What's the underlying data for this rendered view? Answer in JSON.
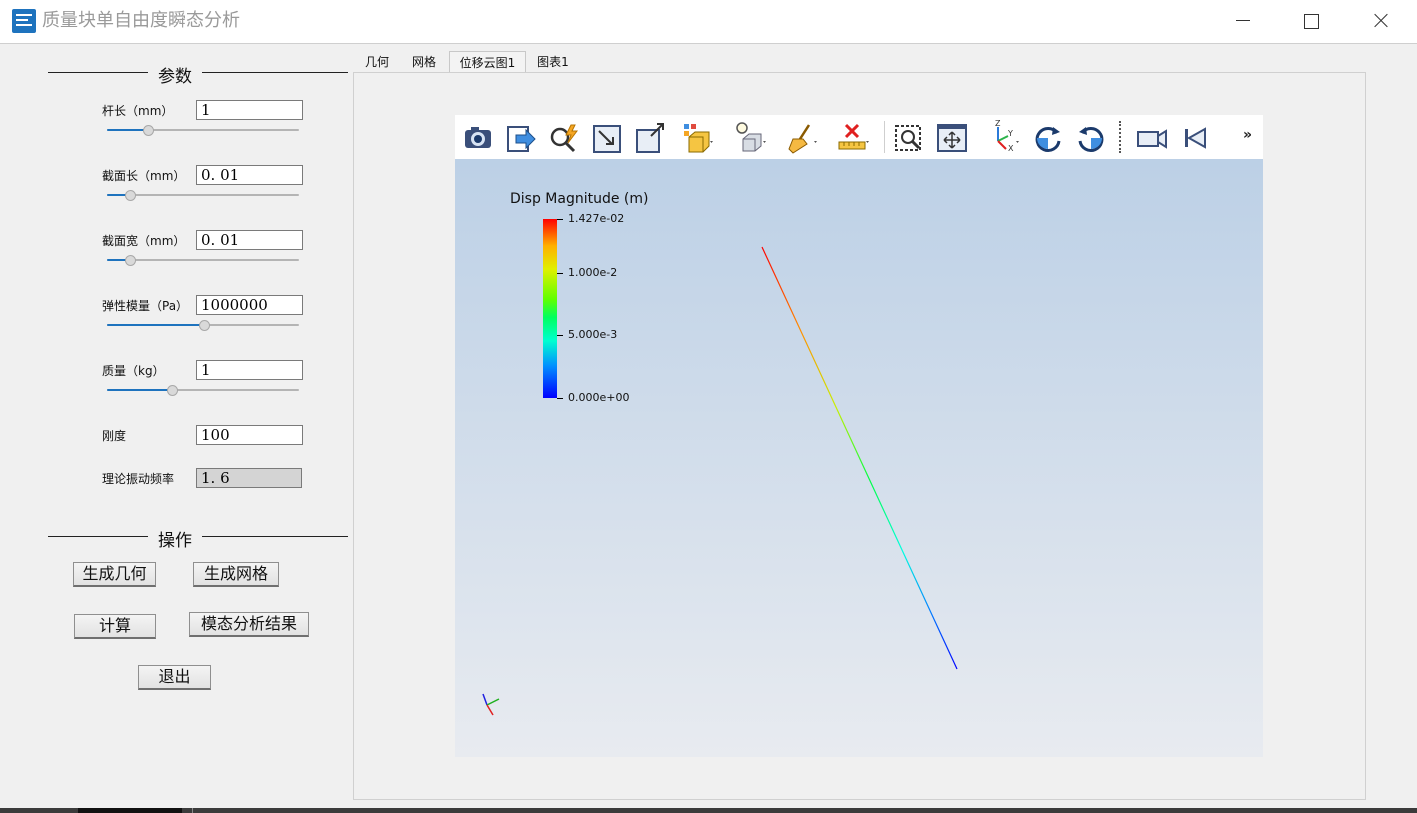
{
  "window": {
    "title": "质量块单自由度瞬态分析"
  },
  "params": {
    "section_title": "参数",
    "rod_length": {
      "label": "杆长（mm）",
      "value": "1",
      "slider_fraction": 0.2
    },
    "section_length": {
      "label": "截面长（mm）",
      "value": "0. 01",
      "slider_fraction": 0.1
    },
    "section_width": {
      "label": "截面宽（mm）",
      "value": "0. 01",
      "slider_fraction": 0.1
    },
    "elastic_modulus": {
      "label": "弹性模量（Pa）",
      "value": "1000000",
      "slider_fraction": 0.51
    },
    "mass": {
      "label": "质量（kg）",
      "value": "1",
      "slider_fraction": 0.33
    },
    "stiffness": {
      "label": "刚度",
      "value": "100"
    },
    "theory_frequency": {
      "label": "理论振动频率",
      "value": "1. 6"
    }
  },
  "ops": {
    "section_title": "操作",
    "gen_geometry": "生成几何",
    "gen_mesh": "生成网格",
    "compute": "计算",
    "modal_result": "模态分析结果",
    "exit": "退出"
  },
  "tabs": [
    {
      "label": "几何",
      "active": false
    },
    {
      "label": "网格",
      "active": false
    },
    {
      "label": "位移云图1",
      "active": true
    },
    {
      "label": "图表1",
      "active": false
    }
  ],
  "toolbar": {
    "icons": [
      "camera-icon",
      "export-icon",
      "interactive-probe-icon",
      "resize-icon",
      "custom-resize-icon",
      "cube-3d-icon",
      "light-icon",
      "clear-icon",
      "ruler-icon",
      "select-icon",
      "reset-camera-icon",
      "axes-xyz-icon",
      "rotate-cw-icon",
      "rotate-ccw-icon",
      "camera-video-icon",
      "first-frame-icon"
    ],
    "more": "»"
  },
  "chart_data": {
    "type": "colorbar",
    "title": "Disp Magnitude (m)",
    "range": [
      0.0,
      0.01427
    ],
    "labels": [
      "1.427e-02",
      "1.000e-2",
      "5.000e-3",
      "0.000e+00"
    ],
    "label_values": [
      0.01427,
      0.01,
      0.005,
      0.0
    ]
  },
  "colors": {
    "accent": "#1e73be",
    "beam_max": "#ff0000",
    "beam_min": "#0000ff"
  }
}
